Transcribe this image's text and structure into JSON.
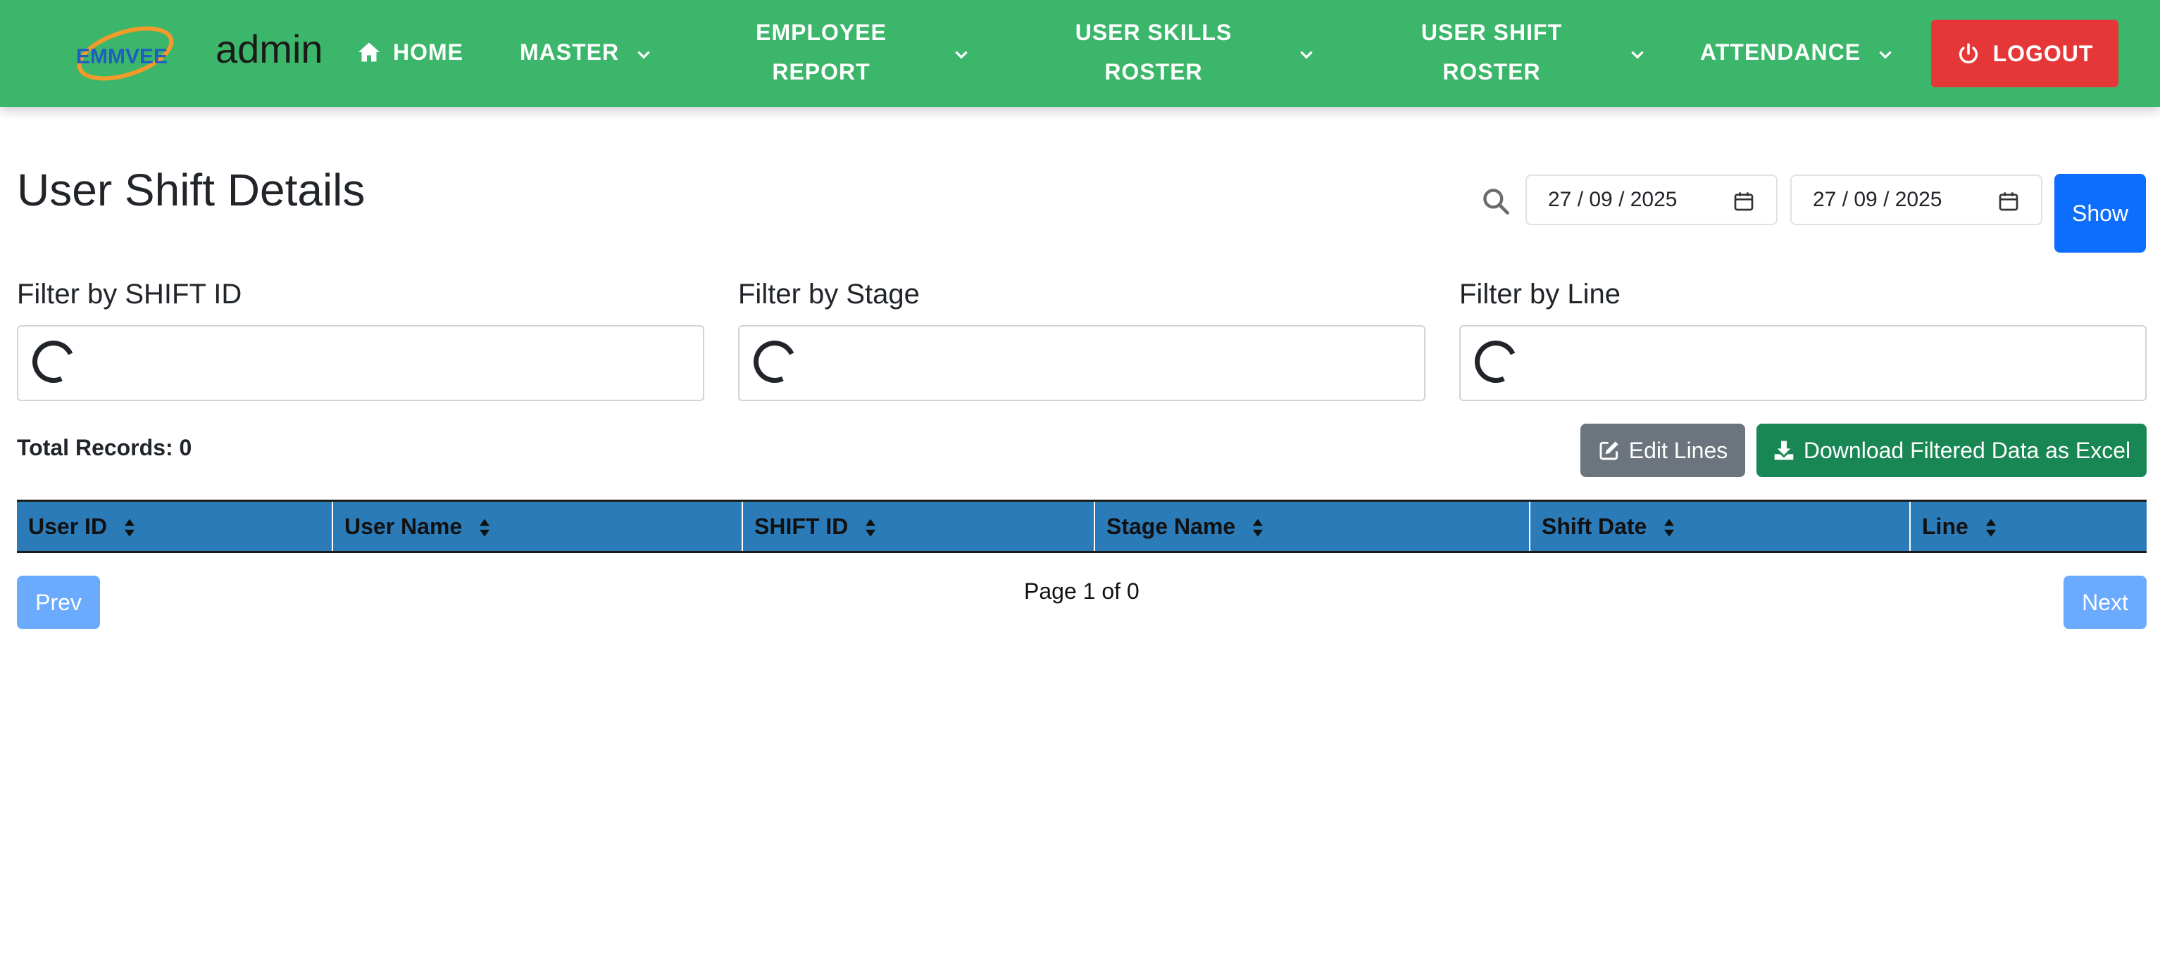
{
  "navbar": {
    "logo_text": "EMMVEE",
    "brand": "admin",
    "home": "HOME",
    "master": "MASTER",
    "employee_report": [
      "EMPLOYEE",
      "REPORT"
    ],
    "user_skills_roster": [
      "USER SKILLS",
      "ROSTER"
    ],
    "user_shift_roster": [
      "USER SHIFT",
      "ROSTER"
    ],
    "attendance": "ATTENDANCE",
    "logout": "LOGOUT",
    "icons": {
      "home": "home-icon",
      "dropdown": "chevron-down-icon",
      "logout": "power-icon"
    }
  },
  "page": {
    "title": "User Shift Details"
  },
  "date_filter": {
    "from": "27 / 09 / 2025",
    "to": "27 / 09 / 2025",
    "show_label": "Show",
    "icons": {
      "search": "search-icon",
      "calendar": "calendar-icon"
    }
  },
  "filters": [
    {
      "label": "Filter by SHIFT ID"
    },
    {
      "label": "Filter by Stage"
    },
    {
      "label": "Filter by Line"
    }
  ],
  "toolbar": {
    "total_records": "Total Records: 0",
    "edit_lines": "Edit Lines",
    "download": "Download Filtered Data as Excel"
  },
  "table": {
    "columns": [
      "User ID",
      "User Name",
      "SHIFT ID",
      "Stage Name",
      "Shift Date",
      "Line"
    ],
    "rows": []
  },
  "pagination": {
    "prev": "Prev",
    "info": "Page 1 of 0",
    "next": "Next"
  },
  "colors": {
    "navbar": "#3cb66a",
    "logout": "#e53738",
    "primary": "#0d6efd",
    "secondary": "#6c757d",
    "success": "#198754",
    "table_header": "#2b7bb9",
    "pagination_disabled": "#6aabfd"
  }
}
